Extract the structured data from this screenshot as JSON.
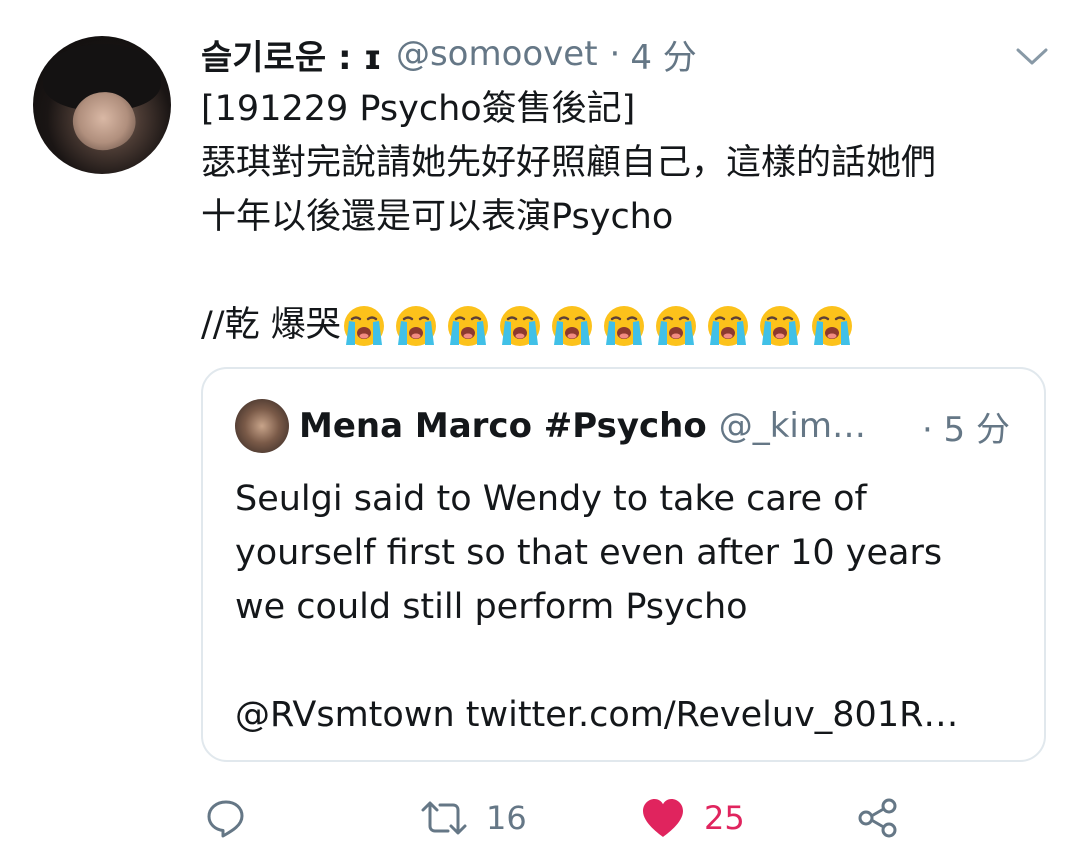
{
  "tweet": {
    "display_name": "슬기로운 : ɪ",
    "handle": "@somoovet",
    "separator": "·",
    "time": "4 分",
    "text_lines": [
      "[191229 Psycho簽售後記]",
      "瑟琪對完說請她先好好照顧自己，這樣的話她們",
      "十年以後還是可以表演Psycho",
      "",
      "//乾 爆哭"
    ],
    "emoji_name": "loudly-crying-face",
    "emoji_count": 10
  },
  "quote": {
    "display_name": "Mena Marco #Psycho",
    "handle": "@_kim…",
    "time": "· 5 分",
    "text_lines": [
      "Seulgi said to Wendy to take care of",
      "yourself first so that even after 10 years",
      "we could still perform Psycho",
      "",
      "@RVsmtown twitter.com/Reveluv_801R…"
    ]
  },
  "actions": {
    "reply_icon": "reply-icon",
    "retweet_icon": "retweet-icon",
    "retweet_count": "16",
    "like_icon": "heart-icon",
    "like_count": "25",
    "share_icon": "share-icon"
  },
  "colors": {
    "text": "#14171a",
    "secondary": "#657786",
    "like": "#e0245e",
    "border": "#e1e8ed"
  }
}
